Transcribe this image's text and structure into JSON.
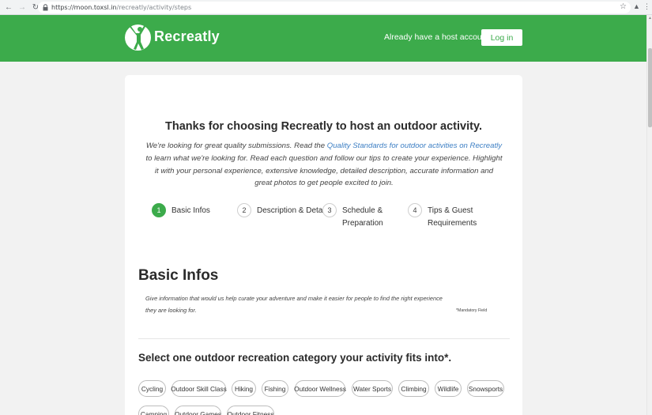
{
  "browser": {
    "url_host": "https://moon.toxsl.in",
    "url_path": "/recreatly/activity/steps"
  },
  "header": {
    "brand": "Recreatly",
    "host_prompt": "Already have a host account?",
    "login_label": "Log in",
    "accent_color": "#3cab4b"
  },
  "intro": {
    "title": "Thanks for choosing Recreatly to host an outdoor activity.",
    "text_before_link": "We're looking for great quality submissions. Read the ",
    "link_text": "Quality Standards for outdoor activities on Recreatly",
    "text_after_link": " to learn what we're looking for. Read each question and follow our tips to create your experience. Highlight it with your personal experience, extensive knowledge, detailed description, accurate information and great photos to get people excited to join."
  },
  "steps": [
    {
      "number": "1",
      "label_line1": "Basic Infos",
      "label_line2": "",
      "active": true
    },
    {
      "number": "2",
      "label_line1": "Description & Details",
      "label_line2": "",
      "active": false
    },
    {
      "number": "3",
      "label_line1": "Schedule &",
      "label_line2": "Preparation",
      "active": false
    },
    {
      "number": "4",
      "label_line1": "Tips & Guest",
      "label_line2": "Requirements",
      "active": false
    }
  ],
  "basic_infos": {
    "title": "Basic Infos",
    "description": "Give information that would us help curate your adventure and make it easier for people to find the right experience they are looking for.",
    "mandatory_note": "*Mandatory Field"
  },
  "category": {
    "title": "Select one outdoor recreation category your activity fits into*.",
    "options": [
      "Cycling",
      "Outdoor Skill Class",
      "Hiking",
      "Fishing",
      "Outdoor Wellness",
      "Water Sports",
      "Climbing",
      "Wildlife",
      "Snowsports",
      "Camping",
      "Outdoor Games",
      "Outdoor Fitness"
    ]
  }
}
